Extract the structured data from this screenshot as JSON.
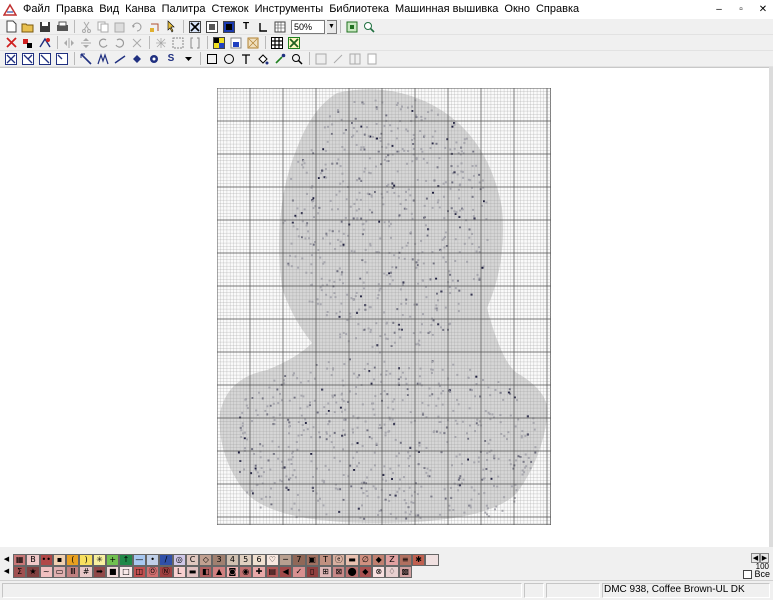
{
  "menu": {
    "items": [
      "Файл",
      "Правка",
      "Вид",
      "Канва",
      "Палитра",
      "Стежок",
      "Инструменты",
      "Библиотека",
      "Машинная вышивка",
      "Окно",
      "Справка"
    ]
  },
  "window_controls": {
    "minimize": "–",
    "restore": "▫",
    "close": "✕"
  },
  "toolbar": {
    "zoom_value": "50%",
    "text_tool_glyph": "T",
    "stitch_glyph": "S"
  },
  "palette": {
    "count": "100",
    "show_all_label": "Все",
    "row1": [
      {
        "c": "#c87878",
        "s": "▦"
      },
      {
        "c": "#f0c8c8",
        "s": "B"
      },
      {
        "c": "#b04848",
        "s": "••"
      },
      {
        "c": "#f0d0b0",
        "s": "▪"
      },
      {
        "c": "#e8a020",
        "s": "("
      },
      {
        "c": "#f8e060",
        "s": ")"
      },
      {
        "c": "#f8f0a0",
        "s": "✳"
      },
      {
        "c": "#70c050",
        "s": "+"
      },
      {
        "c": "#208848",
        "s": "↑"
      },
      {
        "c": "#a8c8f0",
        "s": "—"
      },
      {
        "c": "#c0d0e8",
        "s": "•"
      },
      {
        "c": "#3050a8",
        "s": "/"
      },
      {
        "c": "#d0c8e8",
        "s": "◎"
      },
      {
        "c": "#e0c8c0",
        "s": "C"
      },
      {
        "c": "#c0a090",
        "s": "◇"
      },
      {
        "c": "#a08070",
        "s": "3"
      },
      {
        "c": "#d0c0b0",
        "s": "4"
      },
      {
        "c": "#e0d0c0",
        "s": "5"
      },
      {
        "c": "#f0e0d0",
        "s": "6"
      },
      {
        "c": "#f8e8e0",
        "s": "♡"
      },
      {
        "c": "#b8a090",
        "s": "─"
      },
      {
        "c": "#906858",
        "s": "7"
      },
      {
        "c": "#a07060",
        "s": "▣"
      },
      {
        "c": "#c09080",
        "s": "T"
      },
      {
        "c": "#d8b0a0",
        "s": "ⓔ"
      },
      {
        "c": "#e8c0b0",
        "s": "▬"
      },
      {
        "c": "#d09080",
        "s": "∅"
      },
      {
        "c": "#c08070",
        "s": "◆"
      },
      {
        "c": "#e0a0a0",
        "s": "Z"
      },
      {
        "c": "#b07060",
        "s": "≡"
      },
      {
        "c": "#c06050",
        "s": "✱"
      },
      {
        "c": "#f0e0e0",
        "s": ""
      }
    ],
    "row2": [
      {
        "c": "#a05050",
        "s": "Σ"
      },
      {
        "c": "#804040",
        "s": "★"
      },
      {
        "c": "#f0c0c0",
        "s": "~"
      },
      {
        "c": "#e0b0b0",
        "s": "▭"
      },
      {
        "c": "#c08080",
        "s": "Ⅲ"
      },
      {
        "c": "#e8c8c8",
        "s": "#"
      },
      {
        "c": "#904848",
        "s": "➡"
      },
      {
        "c": "#f0d8d8",
        "s": "■"
      },
      {
        "c": "#f8e8e8",
        "s": "□"
      },
      {
        "c": "#c05050",
        "s": "◫"
      },
      {
        "c": "#d07070",
        "s": "Ⓞ"
      },
      {
        "c": "#a04040",
        "s": "Ⓝ"
      },
      {
        "c": "#f8d0d0",
        "s": "L"
      },
      {
        "c": "#e0c0c0",
        "s": "▬"
      },
      {
        "c": "#b06060",
        "s": "◧"
      },
      {
        "c": "#d08080",
        "s": "▲"
      },
      {
        "c": "#f0b0b0",
        "s": "◙"
      },
      {
        "c": "#c07070",
        "s": "◉"
      },
      {
        "c": "#e8a8a8",
        "s": "✚"
      },
      {
        "c": "#b05858",
        "s": "▤"
      },
      {
        "c": "#a04848",
        "s": "◀"
      },
      {
        "c": "#d89090",
        "s": "✓"
      },
      {
        "c": "#904040",
        "s": "▯"
      },
      {
        "c": "#e0b8b8",
        "s": "⊞"
      },
      {
        "c": "#c88888",
        "s": "⊠"
      },
      {
        "c": "#b87070",
        "s": "⬤"
      },
      {
        "c": "#a85050",
        "s": "◆"
      },
      {
        "c": "#f8e0e0",
        "s": "⊗"
      },
      {
        "c": "#e8d0d0",
        "s": "♢"
      },
      {
        "c": "#d0a0a0",
        "s": "▩"
      }
    ]
  },
  "status": {
    "thread": "DMC  938, Coffee Brown-UL DK"
  }
}
